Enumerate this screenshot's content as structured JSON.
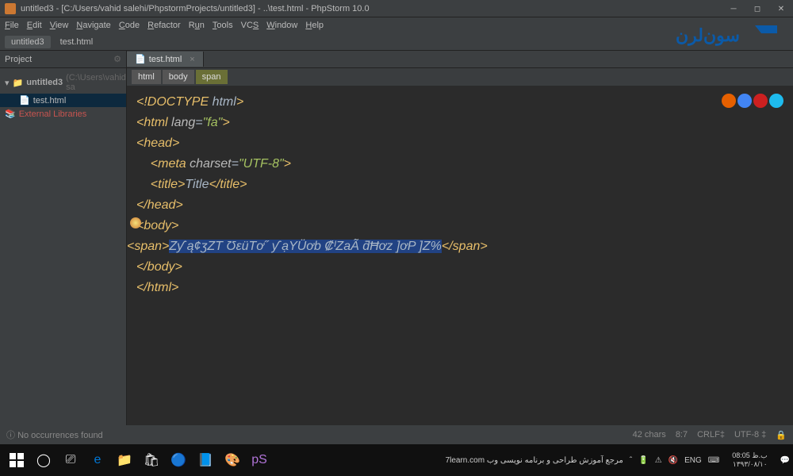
{
  "window": {
    "title": "untitled3 - [C:/Users/vahid salehi/PhpstormProjects/untitled3] - ..\\test.html - PhpStorm 10.0"
  },
  "menu": [
    "File",
    "Edit",
    "View",
    "Navigate",
    "Code",
    "Refactor",
    "Run",
    "Tools",
    "VCS",
    "Window",
    "Help"
  ],
  "crumbs": {
    "project": "untitled3",
    "file": "test.html"
  },
  "sidepanel": {
    "title": "Project"
  },
  "tree": {
    "root": "untitled3",
    "root_hint": "(C:\\Users\\vahid sa",
    "file": "test.html",
    "ext": "External Libraries"
  },
  "tabs": [
    {
      "name": "test.html"
    }
  ],
  "breadcrumb": [
    "html",
    "body",
    "span"
  ],
  "code": {
    "l1_a": "<!DOCTYPE ",
    "l1_b": "html",
    "l1_c": ">",
    "l2_a": "<html ",
    "l2_b": "lang",
    "l2_c": "=",
    "l2_d": "\"fa\"",
    "l2_e": ">",
    "l3": "<head>",
    "l4_a": "<meta ",
    "l4_b": "charset",
    "l4_c": "=",
    "l4_d": "\"UTF-8\"",
    "l4_e": ">",
    "l5_a": "<title>",
    "l5_b": "Title",
    "l5_c": "</title>",
    "l6": "</head>",
    "l7": "<body>",
    "l8_a": "<span>",
    "l8_b": "Zƴ ą¢ʒZT ƱɛüTơ˝ ƴ ạYÜơb ₡ᴵZaÃ ƌĦơz ]ơP ]Z%",
    "l8_c": "</span>",
    "l9": "</body>",
    "l10": "</html>"
  },
  "status": {
    "left": "No occurrences found",
    "chars": "42 chars",
    "pos": "8:7",
    "le": "CRLF‡",
    "enc": "UTF-8 ‡"
  },
  "tray": {
    "text": "7learn.com  مرجع آموزش طراحی و برنامه نویسی وب",
    "lang": "ENG",
    "time": "08:05 ب.ظ",
    "date": "۱۳۹۳/۰۸/۱۰"
  }
}
